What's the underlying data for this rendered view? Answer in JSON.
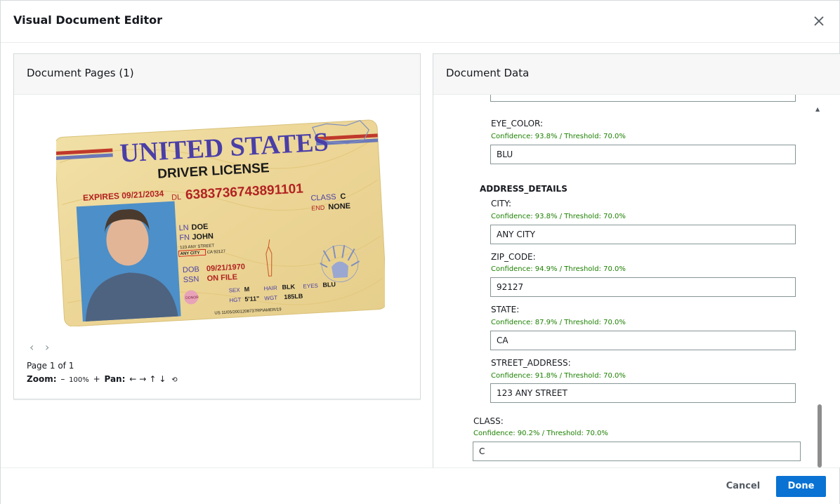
{
  "modal": {
    "title": "Visual Document Editor"
  },
  "pages_panel": {
    "title": "Document Pages (1)",
    "page_indicator": "Page 1 of 1",
    "zoom_label": "Zoom:",
    "zoom_minus": "–",
    "zoom_value": "100%",
    "zoom_plus": "+",
    "pan_label": "Pan:",
    "pan_left": "←",
    "pan_right": "→",
    "pan_up": "↑",
    "pan_down": "↓",
    "reset": "⟲",
    "prev_page": "‹",
    "next_page": "›"
  },
  "document_image": {
    "title_line1": "UNITED STATES",
    "title_line2": "DRIVER LICENSE",
    "expires": "EXPIRES 09/21/2034",
    "dl_label": "DL",
    "dl_number": "6383736743891101",
    "class_label": "CLASS",
    "class_value": "C",
    "end_label": "END",
    "end_value": "NONE",
    "ln_label": "LN",
    "ln_value": "DOE",
    "fn_label": "FN",
    "fn_value": "JOHN",
    "street": "123 ANY STREET",
    "city": "ANY CITY",
    "city_zip": "CA 92127",
    "dob_label": "DOB",
    "dob_value": "09/21/1970",
    "ssn_label": "SSN",
    "ssn_value": "ON FILE",
    "donor": "DONOR",
    "sex_label": "SEX",
    "sex_value": "M",
    "hair_label": "HAIR",
    "hair_value": "BLK",
    "eyes_label": "EYES",
    "eyes_value": "BLU",
    "hgt_label": "HGT",
    "hgt_value": "5'11\"",
    "wgt_label": "WGT",
    "wgt_value": "185LB",
    "us_line": "US 11/05/2001208737RPIAMER/19"
  },
  "data_panel": {
    "title": "Document Data",
    "eye_color": {
      "label": "EYE_COLOR:",
      "confidence": "Confidence: 93.8% / Threshold: 70.0%",
      "value": "BLU"
    },
    "address_section": "ADDRESS_DETAILS",
    "city": {
      "label": "CITY:",
      "confidence": "Confidence: 93.8% / Threshold: 70.0%",
      "value": "ANY CITY"
    },
    "zip": {
      "label": "ZIP_CODE:",
      "confidence": "Confidence: 94.9% / Threshold: 70.0%",
      "value": "92127"
    },
    "state": {
      "label": "STATE:",
      "confidence": "Confidence: 87.9% / Threshold: 70.0%",
      "value": "CA"
    },
    "street": {
      "label": "STREET_ADDRESS:",
      "confidence": "Confidence: 91.8% / Threshold: 70.0%",
      "value": "123 ANY STREET"
    },
    "class": {
      "label": "CLASS:",
      "confidence": "Confidence: 90.2% / Threshold: 70.0%",
      "value": "C"
    }
  },
  "footer": {
    "cancel_label": "Cancel",
    "done_label": "Done"
  },
  "colors": {
    "primary": "#0972d3",
    "confidence": "#1d8102",
    "card_blue": "#4a3ea8",
    "card_red": "#b22222"
  }
}
